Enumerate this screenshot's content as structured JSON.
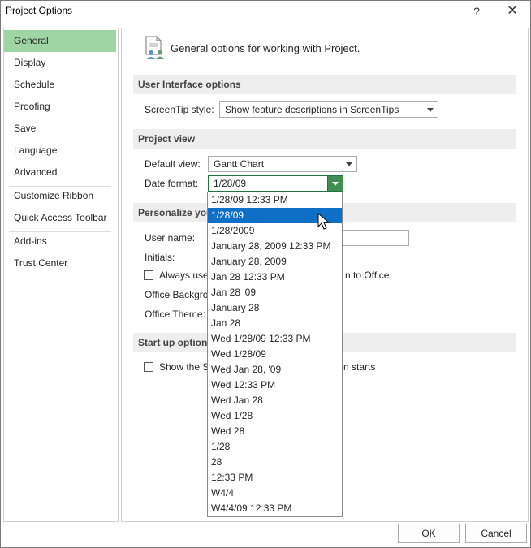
{
  "window": {
    "title": "Project Options",
    "help": "?",
    "close": "✕"
  },
  "nav": {
    "items": [
      {
        "label": "General"
      },
      {
        "label": "Display"
      },
      {
        "label": "Schedule"
      },
      {
        "label": "Proofing"
      },
      {
        "label": "Save"
      },
      {
        "label": "Language"
      },
      {
        "label": "Advanced"
      },
      {
        "label": "Customize Ribbon"
      },
      {
        "label": "Quick Access Toolbar"
      },
      {
        "label": "Add-ins"
      },
      {
        "label": "Trust Center"
      }
    ],
    "selected": "General"
  },
  "content": {
    "intro": "General options for working with Project.",
    "ui_options": {
      "header": "User Interface options",
      "screentip_label": "ScreenTip style:",
      "screentip_value": "Show feature descriptions in ScreenTips"
    },
    "project_view": {
      "header": "Project view",
      "default_view_label": "Default view:",
      "default_view_value": "Gantt Chart",
      "date_format_label": "Date format:",
      "date_format_value": "1/28/09"
    },
    "personalize": {
      "header": "Personalize you",
      "user_name_label": "User name:",
      "initials_label": "Initials:",
      "always_use_label": "Always use",
      "always_use_tail": "n to Office.",
      "office_background_label": "Office Backgro",
      "office_theme_label": "Office Theme:"
    },
    "startup": {
      "header": "Start up options",
      "show_start_label": "Show the S",
      "show_start_tail": "n starts"
    }
  },
  "date_dropdown": {
    "options": [
      "1/28/09 12:33 PM",
      "1/28/09",
      "1/28/2009",
      "January 28, 2009 12:33 PM",
      "January 28, 2009",
      "Jan 28 12:33 PM",
      "Jan 28 '09",
      "January 28",
      "Jan 28",
      "Wed 1/28/09 12:33 PM",
      "Wed 1/28/09",
      "Wed Jan 28, '09",
      "Wed 12:33 PM",
      "Wed Jan 28",
      "Wed 1/28",
      "Wed 28",
      "1/28",
      "28",
      "12:33 PM",
      "W4/4",
      "W4/4/09 12:33 PM"
    ],
    "selected_index": 1
  },
  "buttons": {
    "ok": "OK",
    "cancel": "Cancel"
  },
  "colors": {
    "nav_selected": "#9fd5a4",
    "dropdown_selected": "#0f6fc6",
    "combo_open_accent": "#3f8f55"
  }
}
